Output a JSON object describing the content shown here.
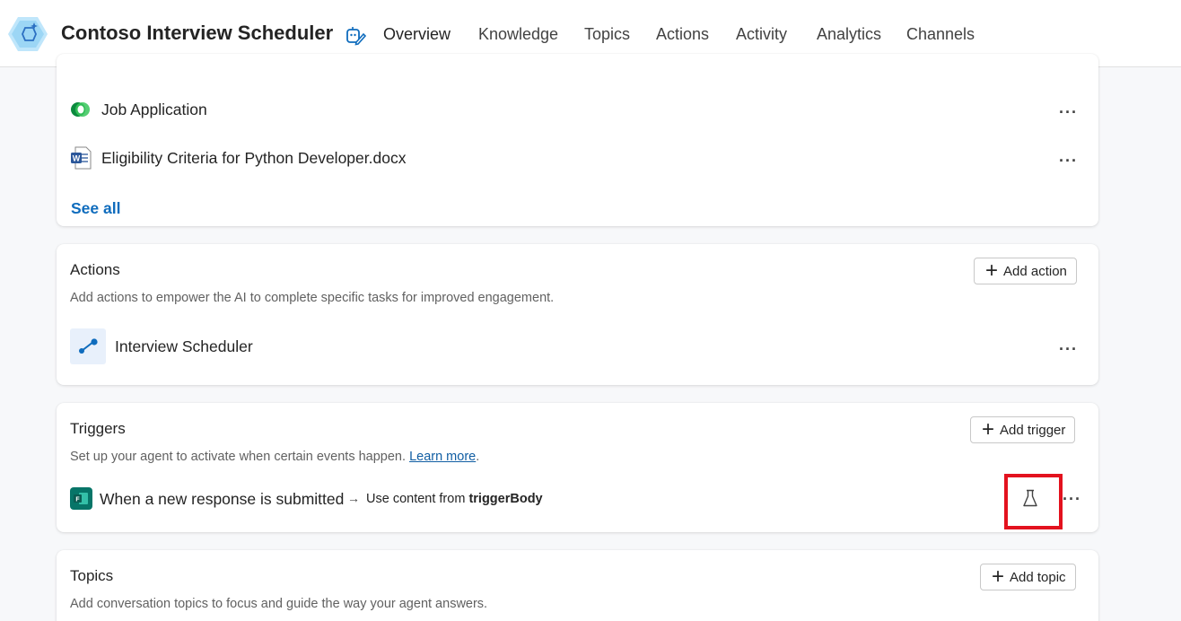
{
  "header": {
    "title": "Contoso Interview Scheduler",
    "tabs": [
      "Overview",
      "Knowledge",
      "Topics",
      "Actions",
      "Activity",
      "Analytics",
      "Channels"
    ],
    "active_tab": "Overview",
    "accent": "#0f6cbd"
  },
  "knowledge": {
    "items": [
      {
        "label": "Job Application",
        "icon": "dataverse-icon"
      },
      {
        "label": "Eligibility Criteria for Python Developer.docx",
        "icon": "word-doc-icon"
      }
    ],
    "see_all": "See all"
  },
  "actions": {
    "title": "Actions",
    "description": "Add actions to empower the AI to complete specific tasks for improved engagement.",
    "add_label": "Add action",
    "items": [
      {
        "label": "Interview Scheduler",
        "icon": "flow-icon"
      }
    ]
  },
  "triggers": {
    "title": "Triggers",
    "description": "Set up your agent to activate when certain events happen.",
    "learn_more": "Learn more",
    "add_label": "Add trigger",
    "item": {
      "label": "When a new response is submitted",
      "arrow": "→",
      "use_prefix": "Use content from",
      "use_value": "triggerBody"
    }
  },
  "topics": {
    "title": "Topics",
    "description": "Add conversation topics to focus and guide the way your agent answers.",
    "add_label": "Add topic"
  },
  "more_label": "···"
}
